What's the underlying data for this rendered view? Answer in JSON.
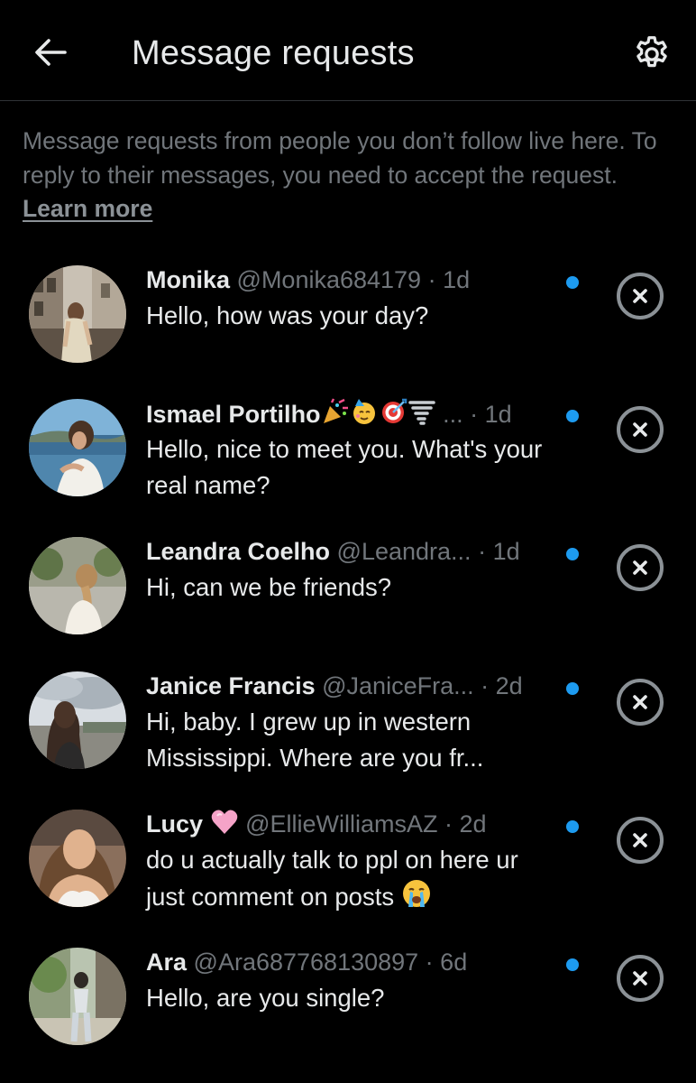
{
  "header": {
    "title": "Message requests",
    "back_icon": "arrow-left-icon",
    "settings_icon": "gear-icon"
  },
  "info": {
    "text": "Message requests from people you don’t follow live here. To reply to their messages, you need to accept the request.",
    "learn_more": "Learn more"
  },
  "colors": {
    "background": "#000000",
    "text_primary": "#e7e9ea",
    "text_secondary": "#71767b",
    "unread_dot": "#1d9bf0",
    "divider": "#2f3336"
  },
  "requests": [
    {
      "name": "Monika",
      "handle": "@Monika684179",
      "sep": " · ",
      "time": "1d",
      "preview": "Hello, how was your day?",
      "unread": true
    },
    {
      "name": "Ismael Portilho",
      "name_emojis": [
        "party-popper-emoji",
        "partying-face-emoji",
        "bullseye-emoji",
        "tornado-emoji"
      ],
      "handle": "...",
      "sep": " · ",
      "time": "1d",
      "preview": "Hello, nice to meet you. What's your real name?",
      "unread": true
    },
    {
      "name": "Leandra Coelho",
      "handle": "@Leandra...",
      "sep": " · ",
      "time": "1d",
      "preview": "Hi, can we be friends?",
      "unread": true
    },
    {
      "name": "Janice Francis",
      "handle": "@JaniceFra...",
      "sep": " · ",
      "time": "2d",
      "preview": "Hi, baby. I grew up in western Mississippi. Where are you fr...",
      "unread": true
    },
    {
      "name": "Lucy",
      "name_emojis": [
        "pink-heart-emoji"
      ],
      "handle": "@EllieWilliamsAZ",
      "sep": " · ",
      "time": "2d",
      "preview": "do u actually talk to ppl on here ur just comment on posts",
      "preview_emoji": "crying-face-emoji",
      "unread": true
    },
    {
      "name": "Ara",
      "handle": "@Ara687768130897",
      "sep": " · ",
      "time": "6d",
      "preview": "Hello, are you single?",
      "unread": true
    }
  ],
  "dismiss_icon": "close-circle-icon"
}
